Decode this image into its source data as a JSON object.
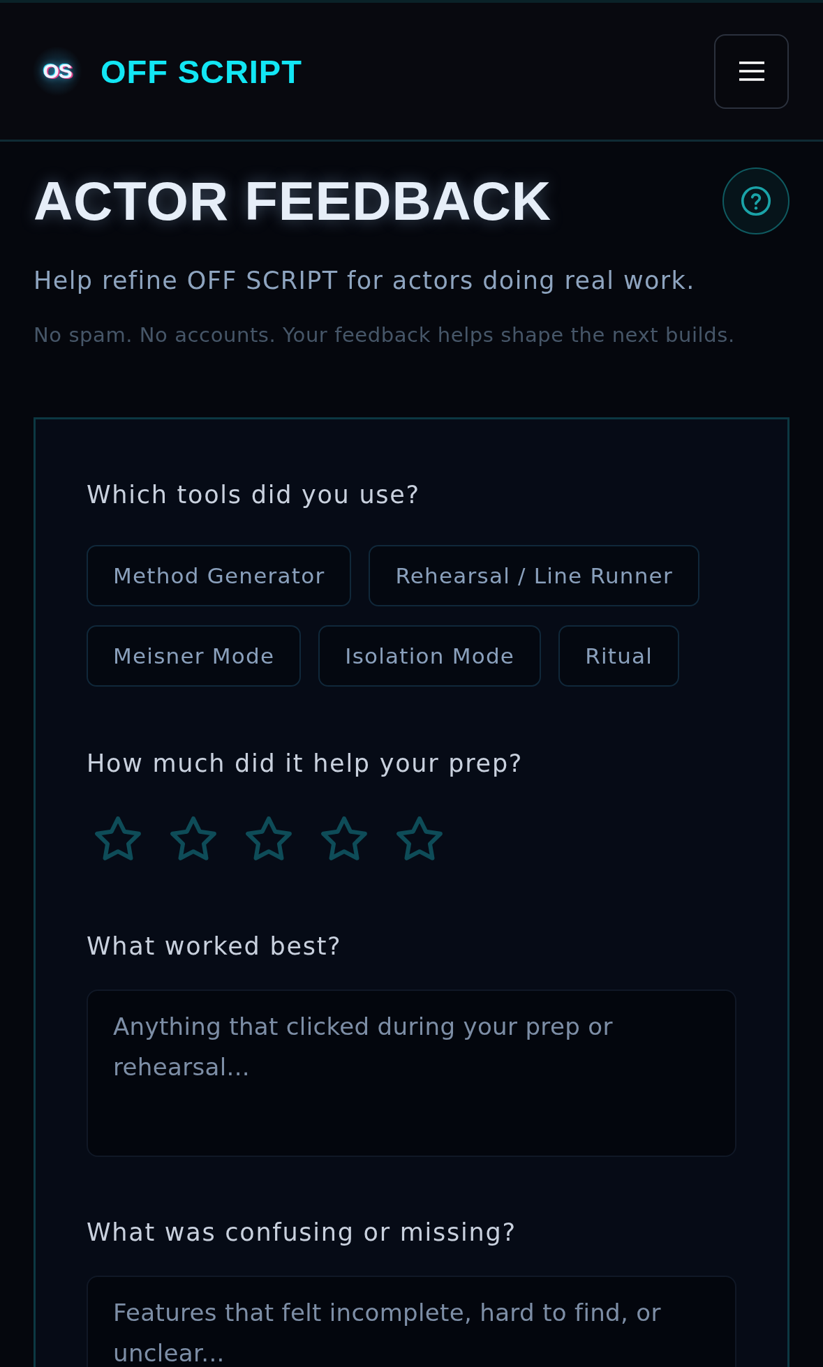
{
  "header": {
    "logo": "OS",
    "brand": "OFF SCRIPT"
  },
  "page": {
    "title": "ACTOR FEEDBACK",
    "subtitle": "Help refine OFF SCRIPT for actors doing real work.",
    "note": "No spam. No accounts. Your feedback helps shape the next builds."
  },
  "form": {
    "tools_question": "Which tools did you use?",
    "tools": [
      {
        "label": "Method Generator",
        "selected": false
      },
      {
        "label": "Rehearsal / Line Runner",
        "selected": false
      },
      {
        "label": "Meisner Mode",
        "selected": false
      },
      {
        "label": "Isolation Mode",
        "selected": false
      },
      {
        "label": "Ritual",
        "selected": false
      }
    ],
    "rating_question": "How much did it help your prep?",
    "rating": {
      "stars": 0
    },
    "worked_best": {
      "label": "What worked best?",
      "placeholder": "Anything that clicked during your prep or rehearsal..."
    },
    "confusing": {
      "label": "What was confusing or missing?",
      "placeholder": "Features that felt incomplete, hard to find, or unclear..."
    }
  }
}
